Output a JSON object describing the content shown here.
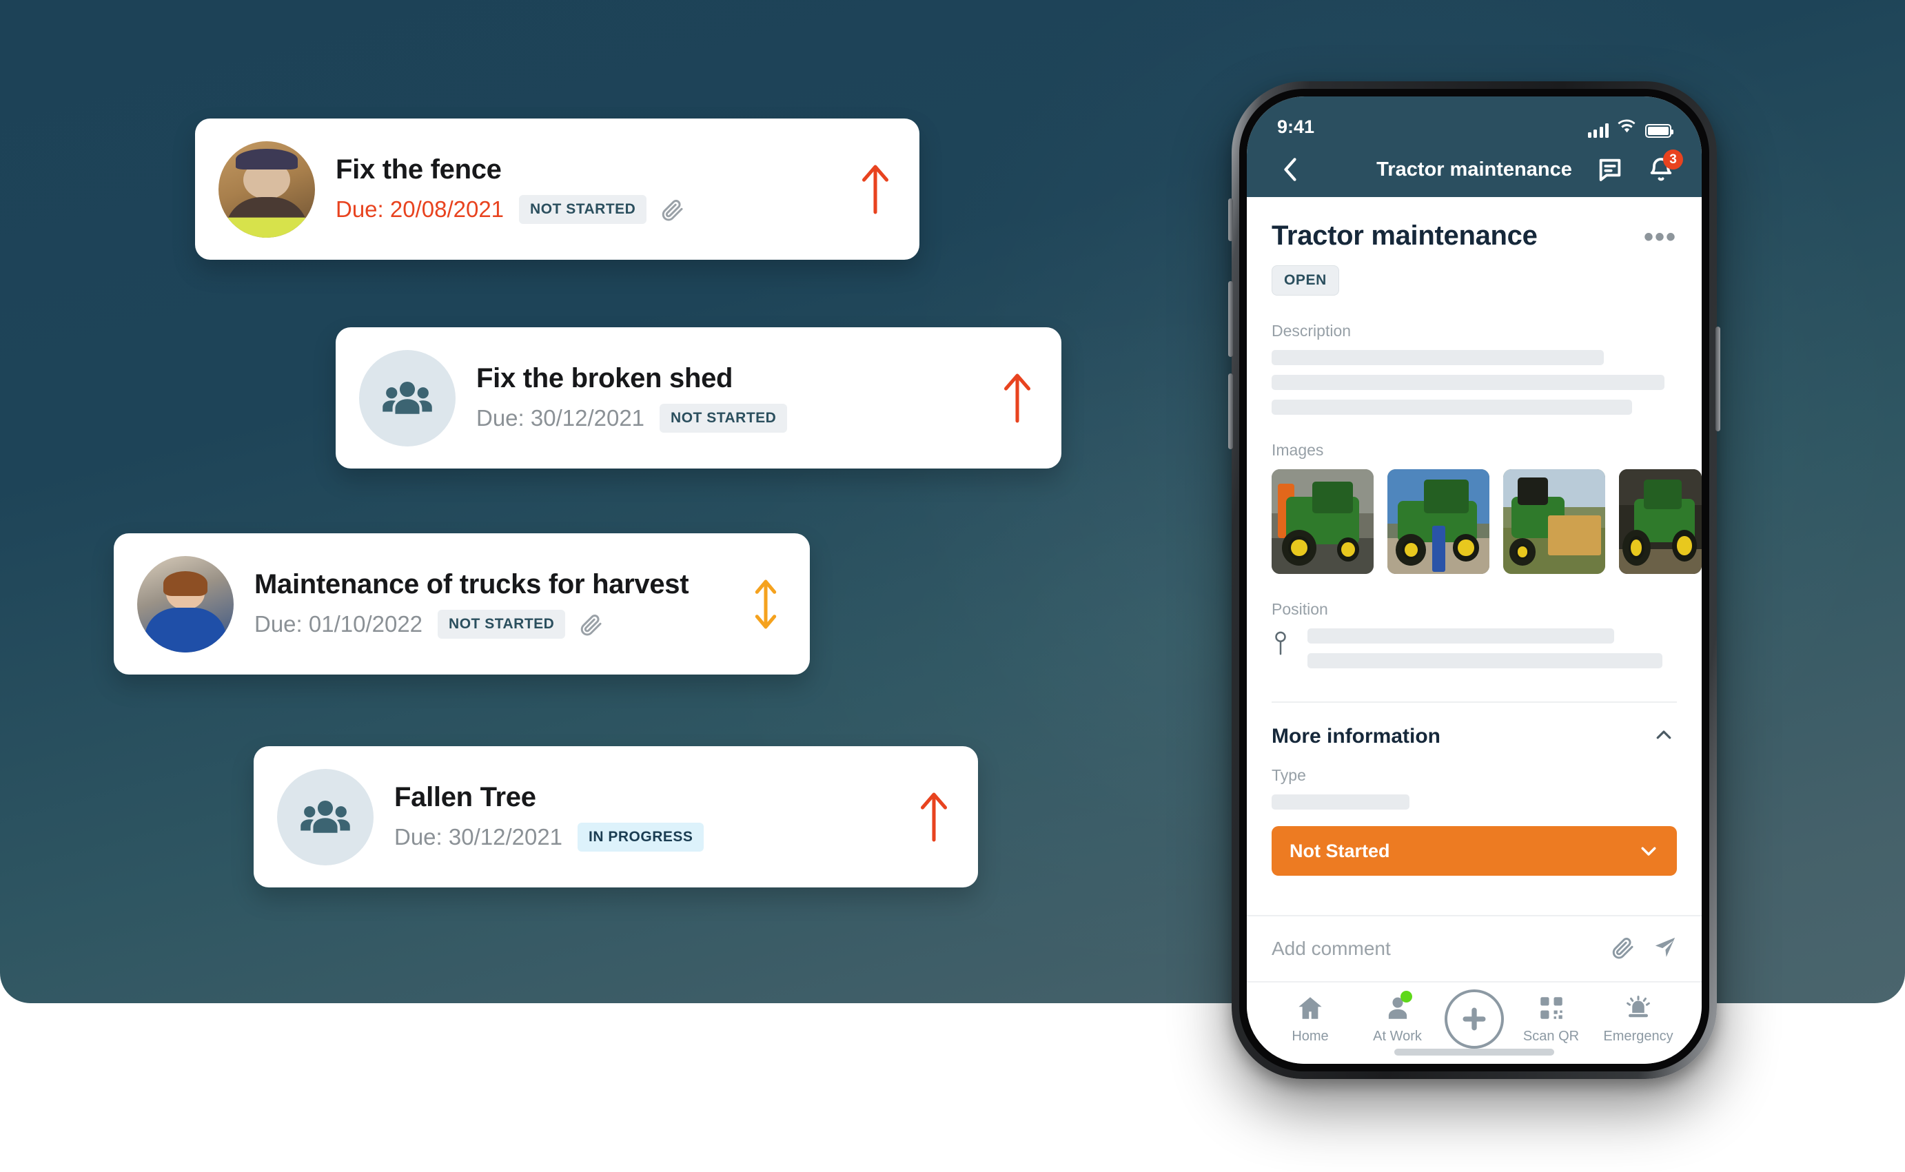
{
  "theme": {
    "panel_dark": "#1d4257",
    "panel_light": "#4a656d",
    "accent_orange": "#ed7b22",
    "priority_red": "#e8431f",
    "status_bar_bg": "#2b4f60",
    "pill_gray_bg": "#eceff2",
    "pill_blue_bg": "#ddf2fb",
    "green_dot": "#5fd81a"
  },
  "tasks": [
    {
      "title": "Fix the fence",
      "due_prefix": "Due:",
      "due_date": "20/08/2021",
      "due_text": "Due: 20/08/2021",
      "status": "NOT STARTED",
      "status_kind": "notstarted",
      "overdue": true,
      "has_attachment": true,
      "avatar_kind": "photo-man",
      "priority_icon": "arrow-up-icon",
      "priority_color": "#e8431f"
    },
    {
      "title": "Fix the broken shed",
      "due_prefix": "Due:",
      "due_date": "30/12/2021",
      "due_text": "Due: 30/12/2021",
      "status": "NOT STARTED",
      "status_kind": "notstarted",
      "overdue": false,
      "has_attachment": false,
      "avatar_kind": "group-icon",
      "priority_icon": "arrow-up-icon",
      "priority_color": "#e8431f"
    },
    {
      "title": "Maintenance of trucks for harvest",
      "due_prefix": "Due:",
      "due_date": "01/10/2022",
      "due_text": "Due: 01/10/2022",
      "status": "NOT STARTED",
      "status_kind": "notstarted",
      "overdue": false,
      "has_attachment": true,
      "avatar_kind": "photo-woman",
      "priority_icon": "arrow-up-down-icon",
      "priority_color": "#f5a21e"
    },
    {
      "title": "Fallen Tree",
      "due_prefix": "Due:",
      "due_date": "30/12/2021",
      "due_text": "Due: 30/12/2021",
      "status": "IN PROGRESS",
      "status_kind": "inprogress",
      "overdue": false,
      "has_attachment": false,
      "avatar_kind": "group-icon",
      "priority_icon": "arrow-up-icon",
      "priority_color": "#e8431f"
    }
  ],
  "phone": {
    "status_bar": {
      "time": "9:41",
      "signal_icon": "cellular-signal-icon",
      "wifi_icon": "wifi-icon",
      "battery_icon": "battery-full-icon"
    },
    "nav": {
      "back_icon": "chevron-left-icon",
      "title": "Tractor maintenance",
      "chat_icon": "chat-bubble-icon",
      "bell_icon": "bell-icon",
      "bell_badge": "3"
    },
    "detail": {
      "title": "Tractor maintenance",
      "overflow_icon": "more-horizontal-icon",
      "state_badge": "OPEN",
      "description_label": "Description",
      "description_skeleton_widths": [
        "82%",
        "97%",
        "89%"
      ],
      "images_label": "Images",
      "image_count": 4,
      "image_alts": [
        "green tractor with orange loader in shed",
        "person standing by large green tracked tractor",
        "green tractor carrying hay bales in field",
        "green tractor parked in barn"
      ],
      "position_label": "Position",
      "position_icon": "map-pin-icon",
      "position_skeleton_widths": [
        "83%",
        "96%"
      ],
      "more_information_label": "More information",
      "more_information_collapse_icon": "chevron-up-icon",
      "type_label": "Type",
      "type_skeleton_width": "34%",
      "status_dropdown_label": "Not Started",
      "status_dropdown_icon": "chevron-down-icon"
    },
    "comment": {
      "placeholder": "Add comment",
      "attach_icon": "paperclip-icon",
      "send_icon": "send-icon"
    },
    "tabbar": {
      "items": [
        {
          "label": "Home",
          "icon": "home-icon",
          "badge": false
        },
        {
          "label": "At Work",
          "icon": "user-icon",
          "badge": true
        },
        {
          "label": "Scan QR",
          "icon": "qr-code-icon",
          "badge": false
        },
        {
          "label": "Emergency",
          "icon": "alarm-icon",
          "badge": false
        }
      ],
      "add_icon": "plus-circle-icon"
    }
  }
}
